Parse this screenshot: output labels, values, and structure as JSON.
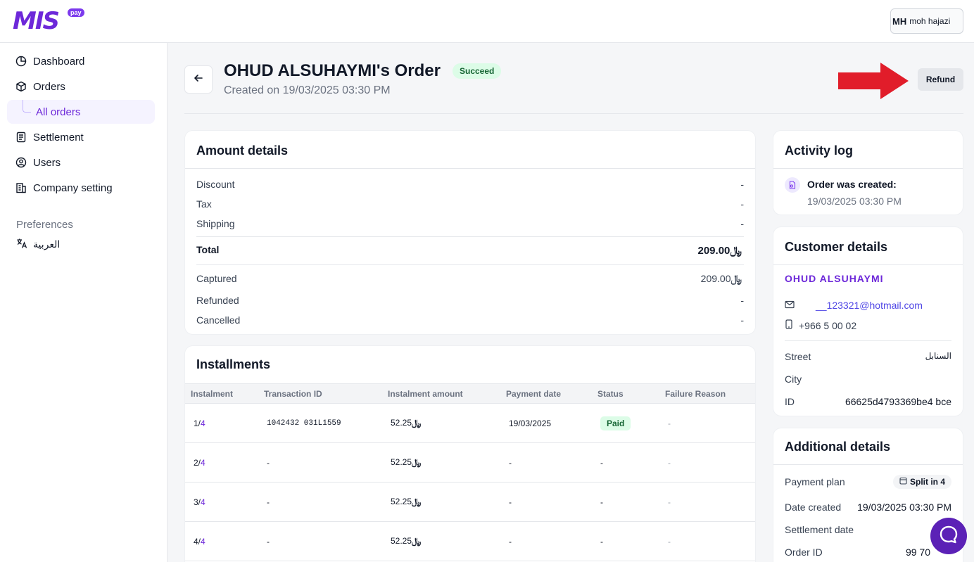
{
  "brand": {
    "name": "MIS",
    "tag": "pay"
  },
  "user": {
    "initials": "MH",
    "name": "moh hajazi"
  },
  "sidebar": {
    "items": [
      {
        "label": "Dashboard",
        "icon": "pie-chart-icon"
      },
      {
        "label": "Orders",
        "icon": "box-icon"
      },
      {
        "label": "All orders"
      },
      {
        "label": "Settlement",
        "icon": "document-icon"
      },
      {
        "label": "Users",
        "icon": "user-circle-icon"
      },
      {
        "label": "Company setting",
        "icon": "building-icon"
      }
    ],
    "preferences_title": "Preferences",
    "language_label": "العربية"
  },
  "order": {
    "title": "OHUD ALSUHAYMI's Order",
    "status": "Succeed",
    "created_on": "Created on 19/03/2025 03:30 PM",
    "refund_label": "Refund"
  },
  "amount_details": {
    "title": "Amount details",
    "discount": {
      "label": "Discount",
      "value": "-"
    },
    "tax": {
      "label": "Tax",
      "value": "-"
    },
    "shipping": {
      "label": "Shipping",
      "value": "-"
    },
    "total": {
      "label": "Total",
      "value": "209.00"
    },
    "captured": {
      "label": "Captured",
      "value": "209.00"
    },
    "refunded": {
      "label": "Refunded",
      "value": "-"
    },
    "cancelled": {
      "label": "Cancelled",
      "value": "-"
    },
    "currency_symbol": "﷼"
  },
  "installments": {
    "title": "Installments",
    "headers": [
      "Instalment",
      "Transaction ID",
      "Instalment amount",
      "Payment date",
      "Status",
      "Failure Reason"
    ],
    "rows": [
      {
        "num": "1/",
        "of": "4",
        "txn": "1042432 031L1559",
        "amount": "52.25",
        "date": "19/03/2025",
        "status": "Paid",
        "reason": "-"
      },
      {
        "num": "2/",
        "of": "4",
        "txn": "-",
        "amount": "52.25",
        "date": "-",
        "status": "-",
        "reason": "-"
      },
      {
        "num": "3/",
        "of": "4",
        "txn": "-",
        "amount": "52.25",
        "date": "-",
        "status": "-",
        "reason": "-"
      },
      {
        "num": "4/",
        "of": "4",
        "txn": "-",
        "amount": "52.25",
        "date": "-",
        "status": "-",
        "reason": "-"
      }
    ]
  },
  "activity": {
    "title": "Activity log",
    "event": "Order was created:",
    "date": "19/03/2025 03:30 PM"
  },
  "customer": {
    "title": "Customer details",
    "name": "OHUD ALSUHAYMI",
    "email": "__123321@hotmail.com",
    "phone": "+966 5   00   02",
    "street": {
      "label": "Street",
      "value": "السنابل"
    },
    "city": {
      "label": "City",
      "value": ""
    },
    "id": {
      "label": "ID",
      "value": "66625d4793369be4   bce"
    }
  },
  "additional": {
    "title": "Additional details",
    "plan": {
      "label": "Payment plan",
      "value": "Split in 4"
    },
    "date_created": {
      "label": "Date created",
      "value": "19/03/2025 03:30 PM"
    },
    "settlement": {
      "label": "Settlement date",
      "value": ""
    },
    "order_id": {
      "label": "Order ID",
      "value": "99 70"
    }
  },
  "colors": {
    "brand": "#6d28d9",
    "success_bg": "#dcfce7",
    "success_text": "#166534",
    "arrow": "#e11d2a"
  }
}
